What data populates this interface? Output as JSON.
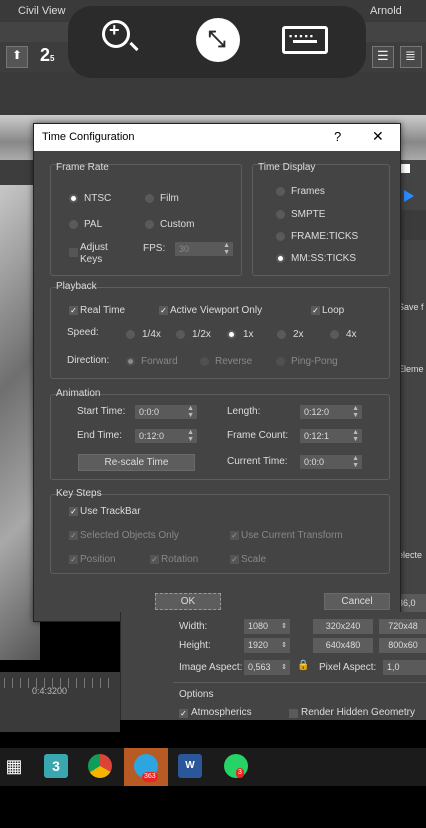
{
  "menubar": {
    "items": [
      "Civil View",
      "Arnold"
    ]
  },
  "toolbar": {
    "number_label": "2",
    "number_sub": "5"
  },
  "right_panel": {
    "save_label": "Save f",
    "element_label": "Eleme",
    "selected_label": "electe",
    "value_label": "36,0"
  },
  "dialog": {
    "title": "Time Configuration",
    "help": "?",
    "close": "✕",
    "frame_rate": {
      "title": "Frame Rate",
      "ntsc": "NTSC",
      "film": "Film",
      "pal": "PAL",
      "custom": "Custom",
      "adjust_keys": "Adjust\nKeys",
      "fps_label": "FPS:",
      "fps_value": "30",
      "selected": "NTSC"
    },
    "time_display": {
      "title": "Time Display",
      "frames": "Frames",
      "smpte": "SMPTE",
      "frame_ticks": "FRAME:TICKS",
      "mmss": "MM:SS:TICKS",
      "selected": "MM:SS:TICKS"
    },
    "playback": {
      "title": "Playback",
      "real_time": "Real Time",
      "active_viewport": "Active Viewport Only",
      "loop": "Loop",
      "speed_label": "Speed:",
      "speeds": [
        "1/4x",
        "1/2x",
        "1x",
        "2x",
        "4x"
      ],
      "speed_selected": "1x",
      "direction_label": "Direction:",
      "directions": [
        "Forward",
        "Reverse",
        "Ping-Pong"
      ],
      "direction_selected": "Forward"
    },
    "animation": {
      "title": "Animation",
      "start_label": "Start Time:",
      "start_value": "0:0:0",
      "end_label": "End Time:",
      "end_value": "0:12:0",
      "length_label": "Length:",
      "length_value": "0:12:0",
      "frame_count_label": "Frame Count:",
      "frame_count_value": "0:12:1",
      "rescale": "Re-scale Time",
      "current_label": "Current Time:",
      "current_value": "0:0:0"
    },
    "key_steps": {
      "title": "Key Steps",
      "use_trackbar": "Use TrackBar",
      "selected_only": "Selected Objects Only",
      "use_transform": "Use Current Transform",
      "position": "Position",
      "rotation": "Rotation",
      "scale": "Scale"
    },
    "ok": "OK",
    "cancel": "Cancel"
  },
  "timeline": {
    "time_label": "0:4:3200"
  },
  "render": {
    "width_label": "Width:",
    "width_value": "1080",
    "preset1": "320x240",
    "preset2": "720x48",
    "height_label": "Height:",
    "height_value": "1920",
    "preset3": "640x480",
    "preset4": "800x60",
    "aspect_label": "Image Aspect:",
    "aspect_value": "0,563",
    "pixel_aspect_label": "Pixel Aspect:",
    "pixel_aspect_value": "1,0",
    "options_label": "Options",
    "atmospherics": "Atmospherics",
    "hidden_geometry": "Render Hidden Geometry"
  },
  "taskbar": {
    "telegram_badge": "363",
    "whatsapp_badge": "3"
  },
  "colors": {
    "dialog_bg": "#444444",
    "accent": "#2a8cff"
  }
}
